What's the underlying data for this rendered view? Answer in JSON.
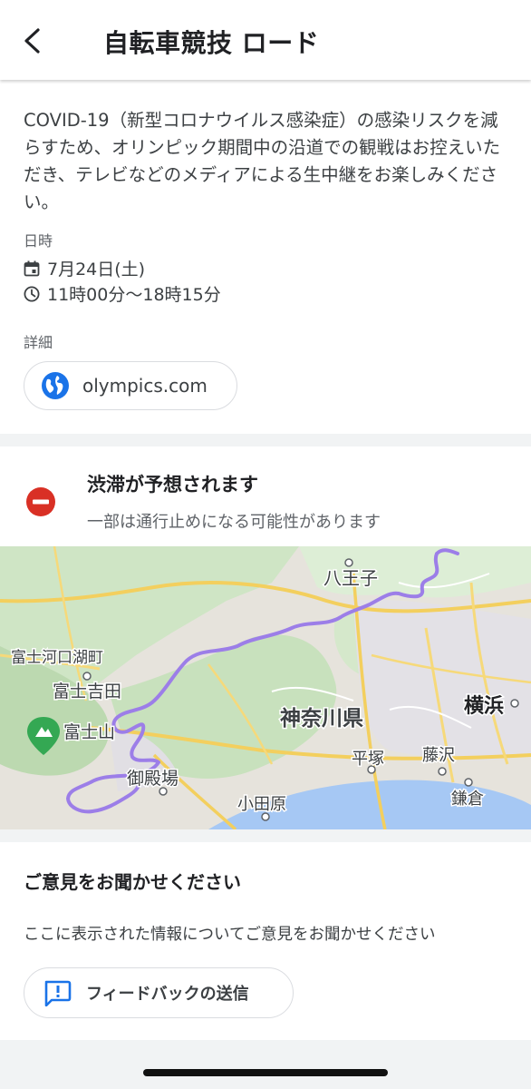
{
  "header": {
    "title": "自転車競技 ロード",
    "back_icon": "arrow-back-icon"
  },
  "info": {
    "notice": "COVID-19（新型コロナウイルス感染症）の感染リスクを減らすため、オリンピック期間中の沿道での観戦はお控えいただき、テレビなどのメディアによる生中継をお楽しみください。",
    "datetime_label": "日時",
    "date": "7月24日(土)",
    "time": "11時00分〜18時15分",
    "details_label": "詳細",
    "link_text": "olympics.com"
  },
  "traffic": {
    "title": "渋滞が予想されます",
    "subtitle": "一部は通行止めになる可能性があります",
    "icon_color": "#d93025"
  },
  "map": {
    "place_labels": [
      "八王子",
      "富士河口湖町",
      "富士吉田",
      "富士山",
      "神奈川県",
      "横浜",
      "平塚",
      "藤沢",
      "御殿場",
      "小田原",
      "鎌倉"
    ],
    "route_color": "#9c7ee8"
  },
  "feedback": {
    "title": "ご意見をお聞かせください",
    "description": "ここに表示された情報についてご意見をお聞かせください",
    "button_label": "フィードバックの送信",
    "accent_color": "#1a73e8"
  }
}
